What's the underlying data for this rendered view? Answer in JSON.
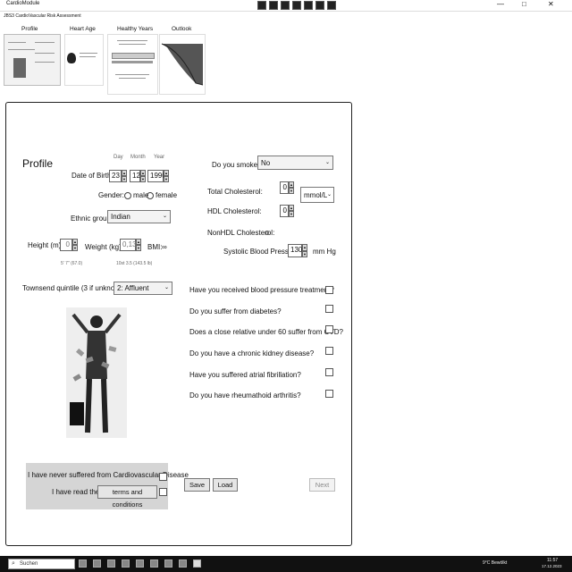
{
  "window": {
    "app_name": "CardioModule",
    "app_title": "JBS3 CardioVascular Risk Assessment",
    "minimize": "—",
    "maximize": "□",
    "close": "✕"
  },
  "thumbnails": [
    {
      "caption": "Profile"
    },
    {
      "caption": "Heart Age"
    },
    {
      "caption": "Healthy Years"
    },
    {
      "caption": "Outlook"
    }
  ],
  "profile": {
    "heading": "Profile",
    "dob_label": "Date of Birth",
    "day_header": "Day",
    "month_header": "Month",
    "year_header": "Year",
    "day": "23",
    "month": "12",
    "year": "1990",
    "gender_label": "Gender:",
    "gender_male": "male",
    "gender_female": "female",
    "ethnic_label": "Ethnic group",
    "ethnic_value": "Indian",
    "height_label": "Height (m):",
    "height_value": "0",
    "height_hint": "5' 7\" (67.0)",
    "weight_label": "Weight (kg):",
    "weight_value": "0,13",
    "weight_hint": "10st 3.5 (143.5 lb)",
    "bmi_label": "BMI:",
    "bmi_value": "∞",
    "townsend_label": "Townsend quintile (3 if unknown):",
    "townsend_value": "2: Affluent"
  },
  "risk": {
    "smoke_label": "Do you smoke?",
    "smoke_value": "No",
    "total_chol_label": "Total Cholesterol:",
    "total_chol_value": "0",
    "chol_unit": "mmol/L",
    "hdl_label": "HDL Cholesterol:",
    "hdl_value": "0",
    "nonhdl_label": "NonHDL Cholesterol:",
    "nonhdl_value": "0",
    "sbp_label": "Systolic Blood Pressure:",
    "sbp_value": "130",
    "sbp_unit": "mm Hg"
  },
  "questions": [
    "Have you received blood pressure treatment?",
    "Do you suffer from diabetes?",
    "Does a close relative under 60 suffer from CVD?",
    "Do you have a chronic kidney disease?",
    "Have you suffered atrial fibrillation?",
    "Do you have rheumathoid arthritis?"
  ],
  "consent": {
    "never_cvd": "I have never suffered from Cardiovascular Disease",
    "read_the": "I have read the",
    "terms_button": "terms and conditions"
  },
  "buttons": {
    "save": "Save",
    "load": "Load",
    "next": "Next"
  },
  "taskbar": {
    "search_placeholder": "Suchen",
    "weather": "9°C  Bewölkt",
    "time": "11:57",
    "date": "17.12.2023"
  }
}
